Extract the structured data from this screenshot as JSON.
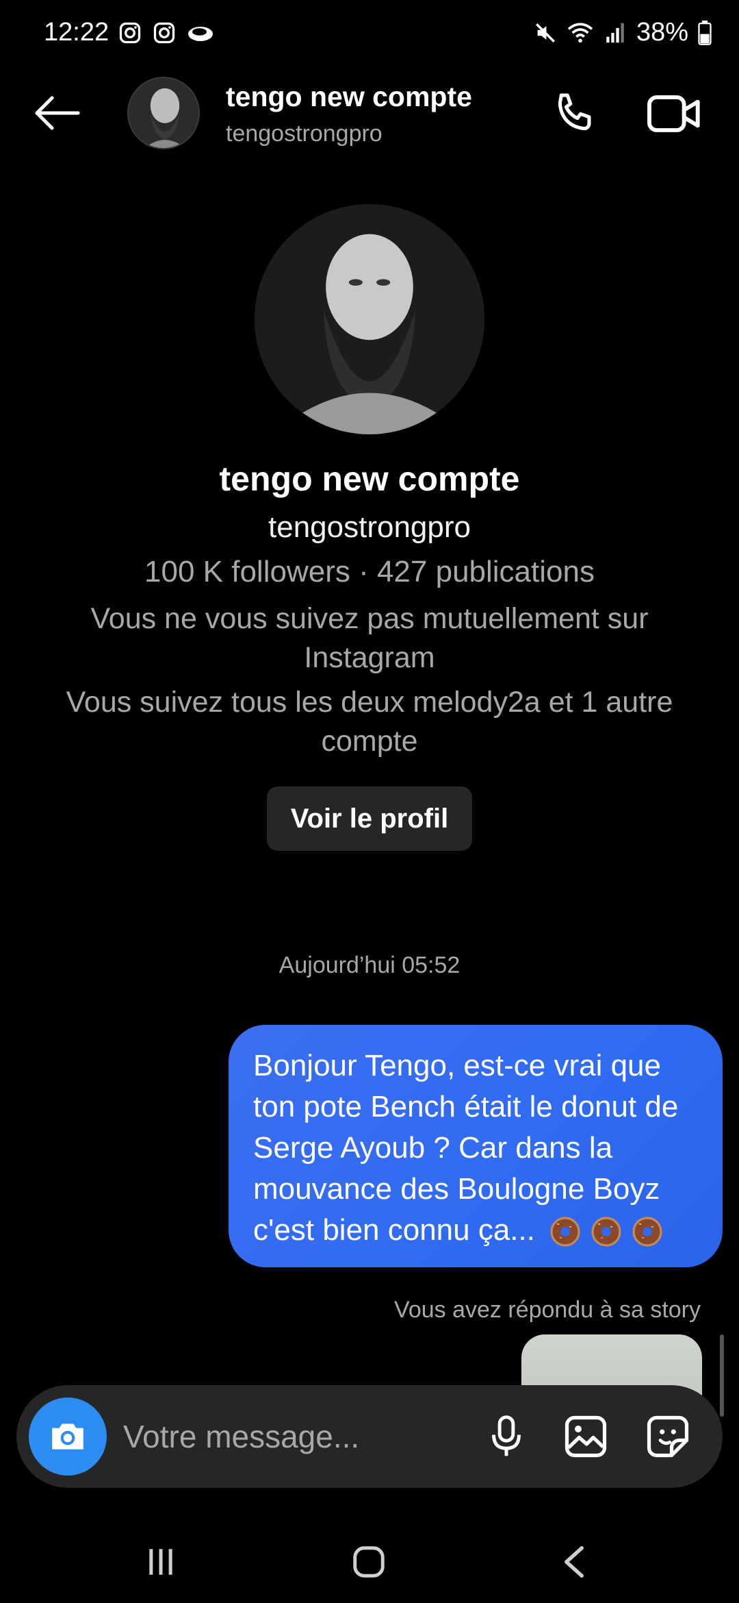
{
  "status_bar": {
    "time": "12:22",
    "battery": "38%",
    "left_icons": [
      "instagram-icon",
      "instagram-icon",
      "cloud-icon"
    ],
    "right_icons": [
      "mute-icon",
      "wifi-icon",
      "signal-icon",
      "battery-icon"
    ]
  },
  "header": {
    "name": "tengo new compte",
    "username": "tengostrongpro",
    "icons": [
      "back-arrow-icon",
      "phone-icon",
      "video-camera-icon"
    ]
  },
  "profile": {
    "name": "tengo new compte",
    "username": "tengostrongpro",
    "stats": "100 K followers · 427 publications",
    "mutual": "Vous ne vous suivez pas mutuellement sur Instagram",
    "common": "Vous suivez tous les deux melody2a et 1 autre compte",
    "view_button": "Voir le profil"
  },
  "chat": {
    "timestamp": "Aujourd’hui 05:52",
    "messages": [
      {
        "text": "Bonjour Tengo, est-ce vrai que ton pote Bench était le donut de Serge Ayoub ? Car dans la mouvance des Boulogne Boyz c'est bien connu ça...",
        "emoji_icon": "donut-icon",
        "emoji_count": 3
      }
    ],
    "story_reply_label": "Vous avez répondu à sa story"
  },
  "composer": {
    "placeholder": "Votre message...",
    "icons": [
      "camera-icon",
      "microphone-icon",
      "gallery-icon",
      "sticker-icon"
    ]
  },
  "colors": {
    "background": "#000000",
    "bubble": "#3c6ef0",
    "camera_button": "#2d8cf0",
    "surface": "#262626",
    "muted_text": "#a8a8a8"
  }
}
